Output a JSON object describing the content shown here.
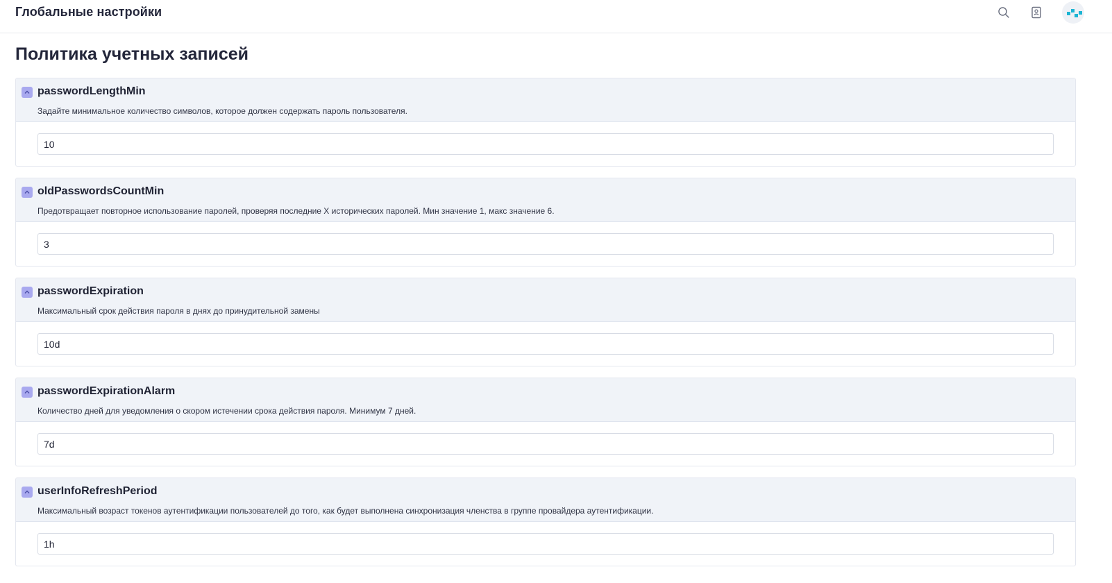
{
  "header": {
    "title": "Глобальные настройки",
    "icons": [
      "search-icon",
      "contact-book-icon",
      "avatar"
    ]
  },
  "page": {
    "title": "Политика учетных записей"
  },
  "settings": [
    {
      "name": "passwordLengthMin",
      "description": "Задайте минимальное количество символов, которое должен содержать пароль пользователя.",
      "value": "10"
    },
    {
      "name": "oldPasswordsCountMin",
      "description": "Предотвращает повторное использование паролей, проверяя последние X исторических паролей. Мин значение 1, макс значение 6.",
      "value": "3"
    },
    {
      "name": "passwordExpiration",
      "description": "Максимальный срок действия пароля в днях до принудительной замены",
      "value": "10d"
    },
    {
      "name": "passwordExpirationAlarm",
      "description": "Количество дней для уведомления о скором истечении срока действия пароля. Минимум 7 дней.",
      "value": "7d"
    },
    {
      "name": "userInfoRefreshPeriod",
      "description": "Максимальный возраст токенов аутентификации пользователей до того, как будет выполнена синхронизация членства в группе провайдера аутентификации.",
      "value": "1h"
    }
  ],
  "colors": {
    "accent": "#a9a9ef",
    "header_bg": "#f0f3f8",
    "avatar_dots": "#1bb5d3"
  }
}
